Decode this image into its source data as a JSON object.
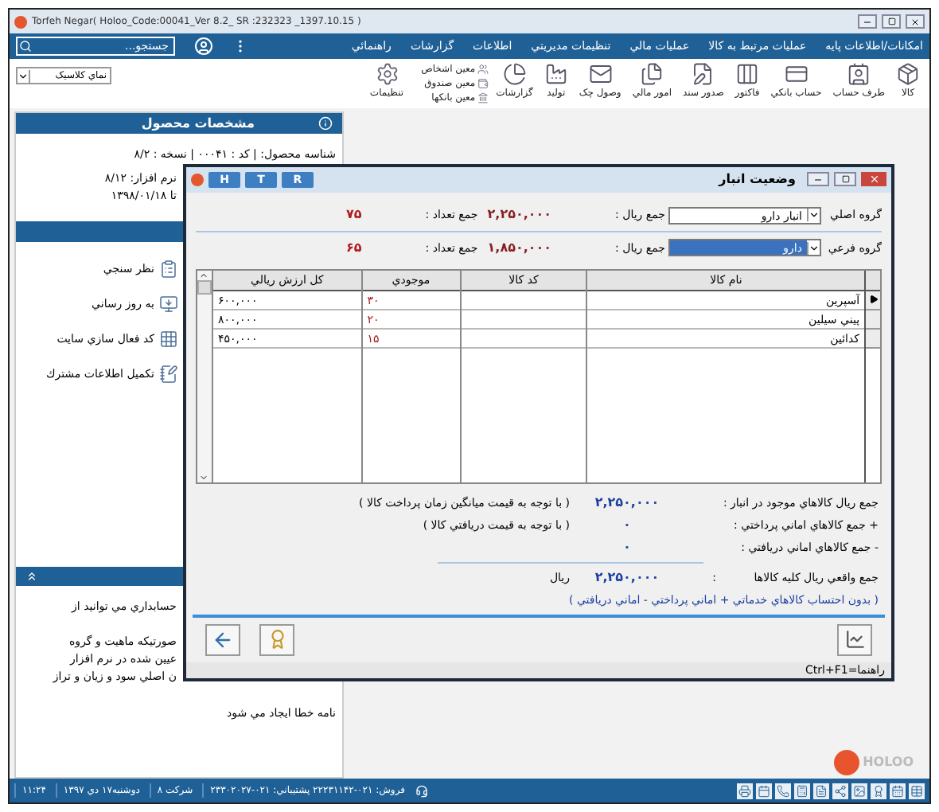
{
  "window": {
    "title": "Torfeh Negar( Holoo_Code:00041_Ver 8.2_ SR :232323 _1397.10.15 )"
  },
  "menu_bar": {
    "items": [
      "امکانات/اطلاعات پايه",
      "عمليات مرتبط به کالا",
      "عمليات مالي",
      "تنظيمات مديريتي",
      "اطلاعات",
      "گزارشات",
      "راهنمائي"
    ],
    "search": {
      "placeholder": "جستجو..."
    }
  },
  "toolbar": {
    "buttons": [
      {
        "label": "کالا",
        "kind": "box"
      },
      {
        "label": "طرف حساب",
        "kind": "contact"
      },
      {
        "label": "حساب بانکي",
        "kind": "bank"
      },
      {
        "label": "فاکتور",
        "kind": "invoice"
      },
      {
        "label": "صدور سند",
        "kind": "document"
      },
      {
        "label": "امور مالي",
        "kind": "finance"
      },
      {
        "label": "وصول چک",
        "kind": "cheque"
      },
      {
        "label": "توليد",
        "kind": "production"
      },
      {
        "label": "گزارشات",
        "kind": "reports"
      }
    ],
    "ledgers": [
      {
        "label": "معين اشخاص",
        "kind": "people"
      },
      {
        "label": "معين صندوق",
        "kind": "cash"
      },
      {
        "label": "معين بانکها",
        "kind": "bank"
      }
    ],
    "settings": "تنظيمات",
    "view": "نماي کلاسيک"
  },
  "product_panel": {
    "title": "مشخصات محصول",
    "lines": [
      "شناسه محصول: | کد : ۰۰۰۴۱ | نسخه : ۸/۲",
      "نرم افزار: ۸/۱۲",
      "تا ۱۳۹۸/۰۱/۱۸"
    ]
  },
  "links_panel": {
    "items": [
      {
        "label": "نظر سنجي",
        "kind": "survey"
      },
      {
        "label": "به روز رساني",
        "kind": "update"
      },
      {
        "label": "کد فعال سازي سايت",
        "kind": "activation"
      },
      {
        "label": "تکميل اطلاعات مشترك",
        "kind": "subscriber"
      }
    ]
  },
  "notes_panel": {
    "lines": [
      "حسابداري مي توانيد از",
      "صورتيکه ماهيت و گروه",
      "عيين شده در نرم افزار",
      "ن اصلي سود و زيان و تراز",
      "نامه خطا ايجاد مي شود"
    ]
  },
  "dialog": {
    "title": "وضعيت انبار",
    "title_buttons": [
      "R",
      "T",
      "H"
    ],
    "groups": [
      {
        "label": "گروه اصلي",
        "value": "انبار دارو",
        "focused": false,
        "rial_label": "جمع ريال :",
        "rial": "۲,۲۵۰,۰۰۰",
        "count_label": "جمع تعداد :",
        "count": "۷۵"
      },
      {
        "label": "گروه فرعي",
        "value": "دارو",
        "focused": true,
        "rial_label": "جمع ريال :",
        "rial": "۱,۸۵۰,۰۰۰",
        "count_label": "جمع تعداد :",
        "count": "۶۵"
      }
    ],
    "table": {
      "columns": [
        "نام کالا",
        "کد کالا",
        "موجودي",
        "کل ارزش ريالي"
      ],
      "rows": [
        {
          "name": "آسپرين",
          "qty": "۳۰",
          "value": "۶۰۰,۰۰۰",
          "selected": true
        },
        {
          "name": "پيني سيلين",
          "qty": "۲۰",
          "value": "۸۰۰,۰۰۰",
          "selected": false
        },
        {
          "name": "کدائين",
          "qty": "۱۵",
          "value": "۴۵۰,۰۰۰",
          "selected": false
        }
      ]
    },
    "summary": [
      {
        "label": "جمع ريال کالاهاي موجود در انبار :",
        "value": "۲,۲۵۰,۰۰۰",
        "note": "( با توجه به قيمت ميانگين زمان پرداخت کالا )"
      },
      {
        "label": "+ جمع کالاهاي اماني پرداختي :",
        "value": "۰",
        "note": "( با توجه به قيمت دريافتي کالا )"
      },
      {
        "label": "- جمع کالاهاي اماني دريافتي :",
        "value": "۰"
      }
    ],
    "total": {
      "label": "جمع واقعي ريال کليه کالاها",
      "separator": ":",
      "value": "۲,۲۵۰,۰۰۰",
      "unit": "ريال"
    },
    "note": "( بدون احتساب کالاهاي خدماتي + اماني پرداختي - اماني دريافتي )",
    "hint": "راهنما=Ctrl+F1"
  },
  "logo": "HOLOO",
  "status_bar": {
    "contacts": "فروش: ۰۲۱-۲۲۲۳۱۱۴۲ پشتيباني: ۰۲۱-۲۳۳۰۲۰۲۷",
    "company": "شرکت ۸",
    "date": "دوشنبه۱۷ دي ۱۳۹۷",
    "time": "۱۱:۲۴"
  }
}
